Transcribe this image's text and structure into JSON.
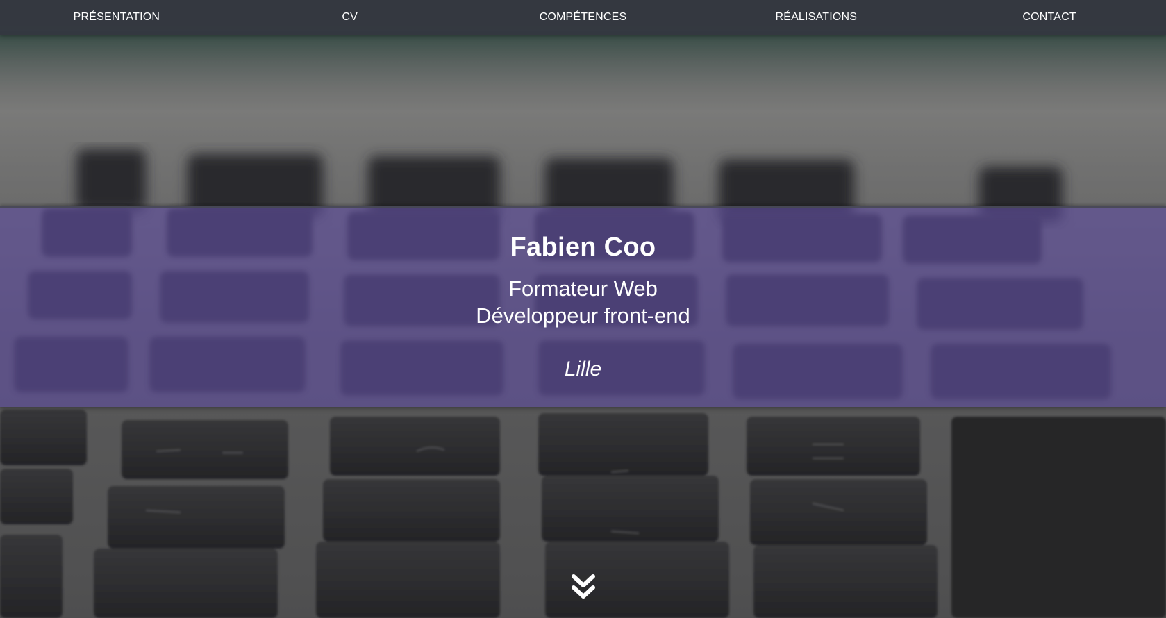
{
  "nav": {
    "items": [
      {
        "label": "PRÉSENTATION"
      },
      {
        "label": "CV"
      },
      {
        "label": "COMPÉTENCES"
      },
      {
        "label": "RÉALISATIONS"
      },
      {
        "label": "CONTACT"
      }
    ]
  },
  "hero": {
    "name": "Fabien Coo",
    "role_line_1": "Formateur Web",
    "role_line_2": "Développeur front-end",
    "city": "Lille"
  },
  "icons": {
    "scroll": "double-chevron-down-icon"
  },
  "colors": {
    "navbar": "#343840",
    "hero_band": "#604ea0",
    "text": "#ffffff"
  }
}
